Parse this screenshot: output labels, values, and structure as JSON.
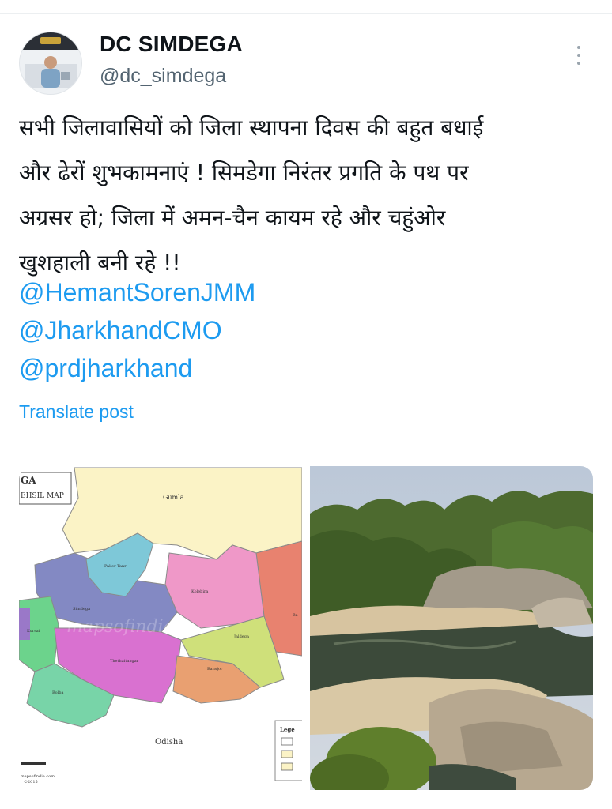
{
  "author": {
    "name": "DC SIMDEGA",
    "handle": "@dc_simdega"
  },
  "tweet": {
    "lines": [
      "सभी जिलावासियों को जिला स्थापना दिवस की बहुत बधाई",
      "और ढेरों शुभकामनाएं ! सिमडेगा निरंतर प्रगति के पथ पर",
      "अग्रसर हो; जिला में अमन-चैन कायम रहे और चहुंओर",
      "खुशहाली बनी रहे !!"
    ],
    "mentions": [
      "@HemantSorenJMM",
      "@JharkhandCMO",
      "@prdjharkhand"
    ],
    "translate_label": "Translate post"
  },
  "map_image": {
    "title_line1": "GA",
    "title_line2": "EHSIL MAP",
    "region_north": "Gumla",
    "region_south": "Odisha",
    "blocks": [
      "Paker Tanr",
      "Kolebira",
      "Simdega",
      "Kursai",
      "Thethaitangar",
      "Jaldega",
      "Bansjor",
      "Bolba",
      "Ba"
    ],
    "legend_label": "Lege",
    "credit_line1": "mapsofindia.com",
    "credit_line2": "©2015",
    "watermark": "mapsofindia"
  },
  "colors": {
    "link": "#1d9bf0",
    "text": "#0f1419",
    "secondary": "#536471"
  }
}
